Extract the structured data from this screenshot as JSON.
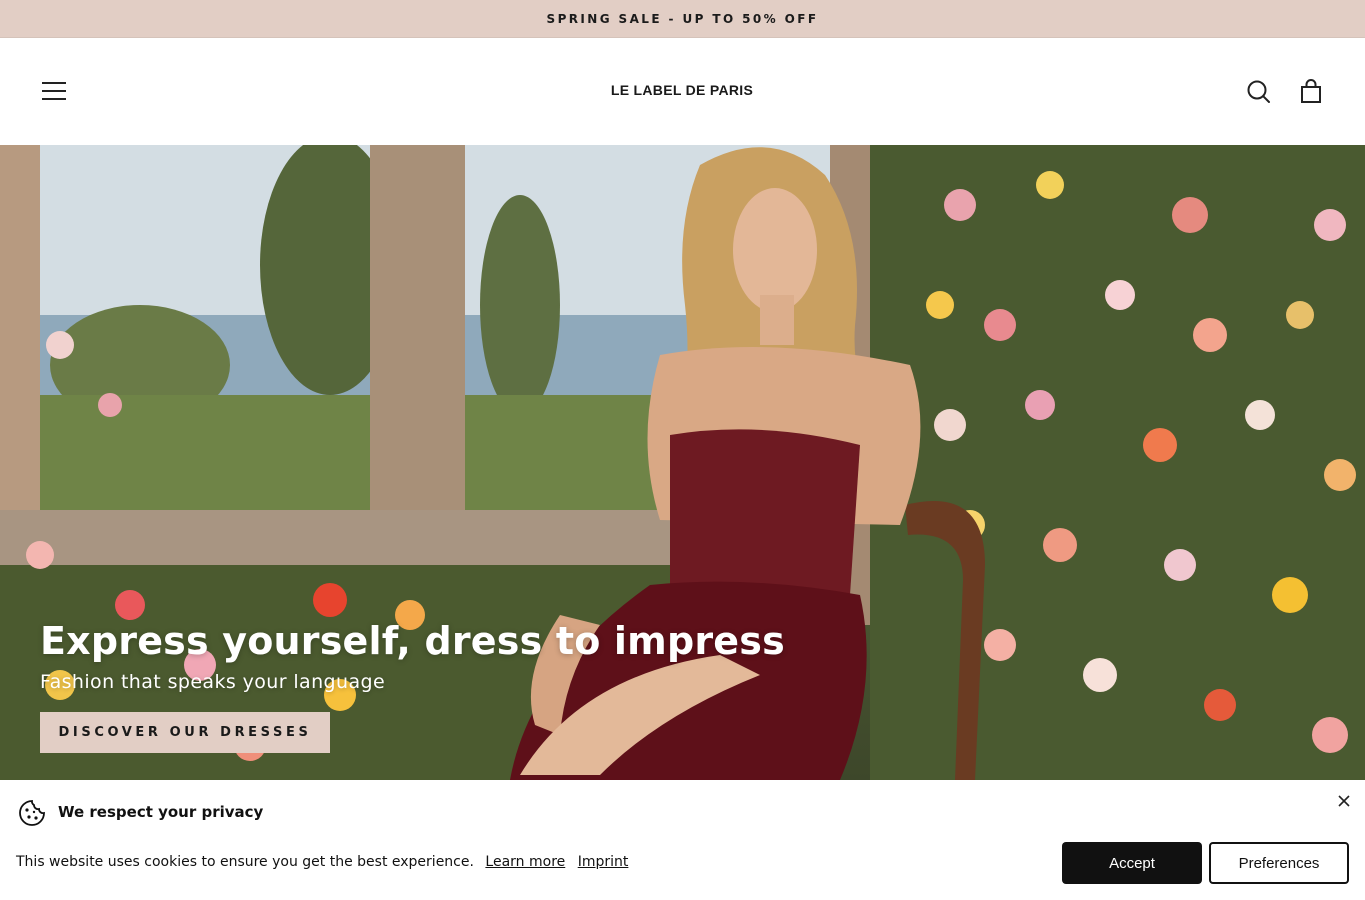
{
  "announcement": {
    "text": "SPRING SALE - UP TO 50% OFF"
  },
  "header": {
    "logo": "LE LABEL DE PARIS",
    "menu_icon": "hamburger-menu-icon",
    "search_icon": "search-icon",
    "cart_icon": "shopping-bag-icon"
  },
  "hero": {
    "title": "Express yourself, dress to impress",
    "subtitle": "Fashion that speaks your language",
    "cta_label": "DISCOVER OUR DRESSES"
  },
  "cookie_banner": {
    "icon": "cookie-icon",
    "title": "We respect your privacy",
    "text": "This website uses cookies to ensure you get the best experience.",
    "learn_more": "Learn more",
    "imprint": "Imprint",
    "accept_label": "Accept",
    "preferences_label": "Preferences",
    "close_icon": "close-icon"
  },
  "colors": {
    "announcement_bg": "#e2cec5",
    "cta_bg": "#e2cec5",
    "accept_bg": "#111111",
    "text": "#111111"
  }
}
